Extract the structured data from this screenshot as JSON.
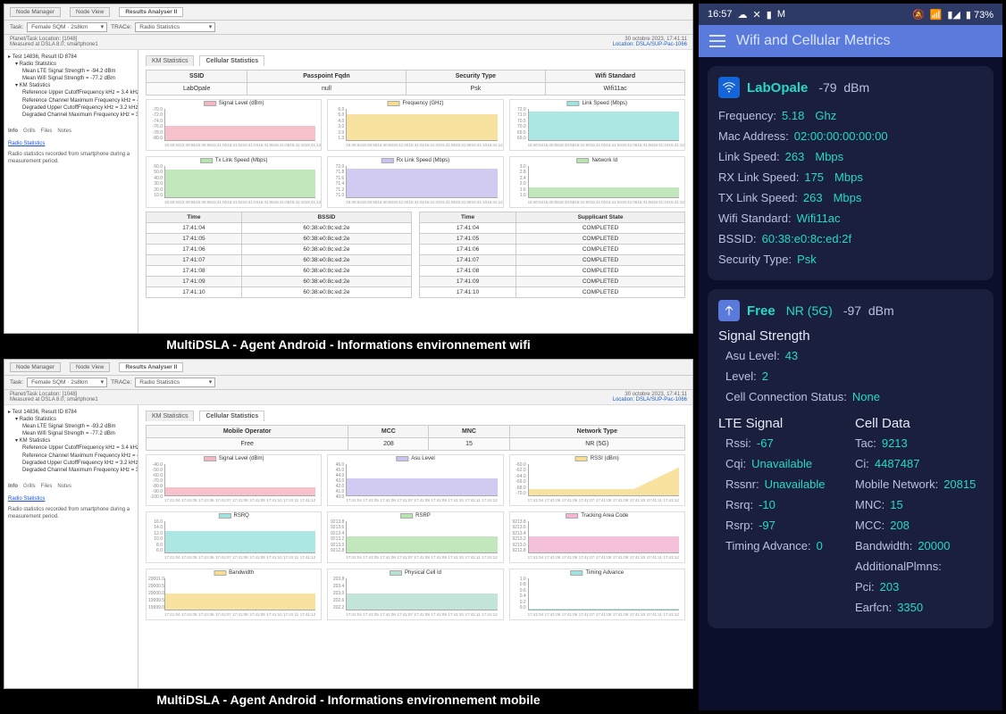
{
  "captions": {
    "wifi": "MultiDSLA - Agent Android - Informations environnement wifi",
    "cellular": "MultiDSLA - Agent Android - Informations environnement mobile"
  },
  "desktop_common": {
    "tabs": {
      "node_manager": "Node Manager",
      "node_view": "Node View",
      "results_analyser": "Results Analyser II"
    },
    "toolbar": {
      "task_label": "Task:",
      "task_value": "Female SQM · 2s8km",
      "trace_label": "TRACe:",
      "trace_value": "Radio Statistics"
    },
    "meta": {
      "left_line1": "Planet/Task Location: [1048]",
      "left_line2": "Measured at DSLA 8.0; smartphone1",
      "right_timestamp": "30 octobre 2023, 17:41:11",
      "right_loc": "Location: DSLA/SUP-Pac-1066"
    },
    "chart_tabs": {
      "km": "KM Statistics",
      "cellular": "Cellular Statistics"
    }
  },
  "wifi_panel": {
    "tree": {
      "root": "Test 14836, Result ID 8784",
      "children": [
        "Radio Statistics",
        "Mean LTE Signal Strength = -94.2 dBm",
        "Mean Wifi Signal Strength = -77.2 dBm",
        "KM Statistics",
        "Reference Upper CutoffFrequency kHz = 3.4 kHz",
        "Reference Channel Maximum Frequency kHz = 4.0 kHz",
        "Degraded Upper CutoffFrequency kHz = 3.2 kHz",
        "Degraded Channel Maximum Frequency kHz = 3.7 kHz"
      ],
      "bottom_tabs": [
        "Info",
        "Grills",
        "Files",
        "Notes"
      ],
      "link": "Radio Statistics",
      "description": "Radio statistics recorded from smartphone during a measurement period."
    },
    "info_headers": [
      "SSID",
      "Passpoint Fqdn",
      "Security Type",
      "Wifi Standard"
    ],
    "info_values": [
      "LabOpale",
      "null",
      "Psk",
      "Wifi11ac"
    ],
    "charts": [
      {
        "name": "Signal Level (dBm)",
        "color": "#f4b6c2",
        "yticks": [
          "-70.0",
          "-72.0",
          "-74.0",
          "-76.0",
          "-78.0",
          "-80.0"
        ],
        "fill_top": 0.55
      },
      {
        "name": "Frequency (GHz)",
        "color": "#f7dd8f",
        "yticks": [
          "6.0",
          "5.0",
          "4.0",
          "3.0",
          "2.0",
          "1.0"
        ],
        "fill_top": 0.18
      },
      {
        "name": "Link Speed (Mbps)",
        "color": "#9fe3df",
        "yticks": [
          "72.0",
          "71.0",
          "70.5",
          "70.0",
          "69.5",
          "69.0"
        ],
        "fill_top": 0.08
      },
      {
        "name": "Tx Link Speed (Mbps)",
        "color": "#b7e3b0",
        "yticks": [
          "60.0",
          "50.0",
          "40.0",
          "30.0",
          "20.0",
          "10.0"
        ],
        "fill_top": 0.1
      },
      {
        "name": "Rx Link Speed (Mbps)",
        "color": "#c9c1ef",
        "yticks": [
          "72.0",
          "71.8",
          "71.6",
          "71.4",
          "71.2",
          "71.0"
        ],
        "fill_top": 0.08
      },
      {
        "name": "Network Id",
        "color": "#b7e3b0",
        "yticks": [
          "3.0",
          "2.8",
          "2.4",
          "2.0",
          "1.6",
          "1.0"
        ],
        "fill_top": 0.68
      }
    ],
    "xticks": [
      "15:40:54",
      "15:40:56",
      "15:40:58",
      "15:41:00",
      "15:41:02",
      "15:41:04",
      "15:41:06",
      "15:41:08",
      "15:41:10",
      "15:41:12"
    ],
    "table_left": {
      "headers": [
        "Time",
        "BSSID"
      ],
      "rows": [
        [
          "17:41:04",
          "60:38:e0:8c:ed:2e"
        ],
        [
          "17:41:05",
          "60:38:e0:8c:ed:2e"
        ],
        [
          "17:41:06",
          "60:38:e0:8c:ed:2e"
        ],
        [
          "17:41:07",
          "60:38:e0:8c:ed:2e"
        ],
        [
          "17:41:08",
          "60:38:e0:8c:ed:2e"
        ],
        [
          "17:41:09",
          "60:38:e0:8c:ed:2e"
        ],
        [
          "17:41:10",
          "60:38:e0:8c:ed:2e"
        ]
      ]
    },
    "table_right": {
      "headers": [
        "Time",
        "Supplicant State"
      ],
      "rows": [
        [
          "17:41:04",
          "COMPLETED"
        ],
        [
          "17:41:05",
          "COMPLETED"
        ],
        [
          "17:41:06",
          "COMPLETED"
        ],
        [
          "17:41:07",
          "COMPLETED"
        ],
        [
          "17:41:08",
          "COMPLETED"
        ],
        [
          "17:41:09",
          "COMPLETED"
        ],
        [
          "17:41:10",
          "COMPLETED"
        ]
      ]
    }
  },
  "cell_panel": {
    "tree": {
      "root": "Test 14836, Result ID 8784",
      "children": [
        "Radio Statistics",
        "Mean LTE Signal Strength = -93.2 dBm",
        "Mean Wifi Signal Strength = -77.2 dBm",
        "KM Statistics",
        "Reference Upper CutoffFrequency kHz = 3.4 kHz",
        "Reference Channel Maximum Frequency kHz = 4.0 kHz",
        "Degraded Upper CutoffFrequency kHz = 3.2 kHz",
        "Degraded Channel Maximum Frequency kHz = 3.7 kHz"
      ],
      "bottom_tabs": [
        "Info",
        "Grills",
        "Files",
        "Notes"
      ],
      "link": "Radio Statistics",
      "description": "Radio statistics recorded from smartphone during a measurement period."
    },
    "info_headers": [
      "Mobile Operator",
      "MCC",
      "MNC",
      "Network Type"
    ],
    "info_values": [
      "Free",
      "208",
      "15",
      "NR (5G)"
    ],
    "charts": [
      {
        "name": "Signal Level (dBm)",
        "color": "#f4b6c2",
        "yticks": [
          "-40.0",
          "-50.0",
          "-60.0",
          "-70.0",
          "-80.0",
          "-90.0",
          "-100.0"
        ],
        "fill_top": 0.75
      },
      {
        "name": "Asu Level",
        "color": "#c9c1ef",
        "yticks": [
          "46.0",
          "45.0",
          "44.0",
          "43.0",
          "42.0",
          "41.0",
          "40.0"
        ],
        "fill_top": 0.45
      },
      {
        "name": "RSSI (dBm)",
        "color": "#f7dd8f",
        "yticks": [
          "-60.0",
          "-62.0",
          "-64.0",
          "-66.0",
          "-68.0",
          "-70.0"
        ],
        "fill_top": 0.15,
        "slope": true
      },
      {
        "name": "RSRQ",
        "color": "#9fe3df",
        "yticks": [
          "16.0",
          "14.0",
          "12.0",
          "10.0",
          "8.0",
          "6.0"
        ],
        "fill_top": 0.3
      },
      {
        "name": "RSRP",
        "color": "#b7e3b0",
        "yticks": [
          "9213.8",
          "9213.6",
          "9213.4",
          "9213.2",
          "9213.0",
          "9212.8"
        ],
        "fill_top": 0.48
      },
      {
        "name": "Tracking Area Code",
        "color": "#f2b5d4",
        "yticks": [
          "9213.8",
          "9213.6",
          "9213.4",
          "9213.2",
          "9213.0",
          "9212.8"
        ],
        "fill_top": 0.48
      },
      {
        "name": "Bandwidth",
        "color": "#f7dd8f",
        "yticks": [
          "20001.0",
          "20000.5",
          "20000.0",
          "19999.5",
          "19999.0"
        ],
        "fill_top": 0.48
      },
      {
        "name": "Physical Cell Id",
        "color": "#b8e0d2",
        "yticks": [
          "203.8",
          "203.4",
          "203.0",
          "202.6",
          "202.2"
        ],
        "fill_top": 0.48
      },
      {
        "name": "Timing Advance",
        "color": "#9fe3df",
        "yticks": [
          "1.0",
          "0.8",
          "0.6",
          "0.4",
          "0.2",
          "0.0"
        ],
        "fill_top": 0.96
      }
    ],
    "xticks": [
      "17:41:04",
      "17:41:05",
      "17:41:06",
      "17:41:07",
      "17:41:08",
      "17:41:09",
      "17:41:10",
      "17:41:11",
      "17:41:12"
    ]
  },
  "phone": {
    "status": {
      "time": "16:57",
      "battery": "73%"
    },
    "app_title": "Wifi and Cellular Metrics",
    "wifi": {
      "ssid": "LabOpale",
      "signal": "-79",
      "unit": "dBm",
      "rows": [
        {
          "k": "Frequency:",
          "v": "5.18",
          "u": "Ghz"
        },
        {
          "k": "Mac Address:",
          "v": "02:00:00:00:00:00"
        },
        {
          "k": "Link Speed:",
          "v": "263",
          "u": "Mbps"
        },
        {
          "k": "RX Link Speed:",
          "v": "175",
          "u": "Mbps"
        },
        {
          "k": "TX Link Speed:",
          "v": "263",
          "u": "Mbps"
        },
        {
          "k": "Wifi Standard:",
          "v": "Wifi11ac"
        },
        {
          "k": "BSSID:",
          "v": "60:38:e0:8c:ed:2f"
        },
        {
          "k": "Security Type:",
          "v": "Psk"
        }
      ]
    },
    "cell": {
      "op": "Free",
      "tech": "NR (5G)",
      "signal": "-97",
      "unit": "dBm",
      "strength_title": "Signal Strength",
      "strength": [
        {
          "k": "Asu Level:",
          "v": "43"
        },
        {
          "k": "Level:",
          "v": "2"
        },
        {
          "k": "Cell Connection Status:",
          "v": "None"
        }
      ],
      "lte_title": "LTE Signal",
      "cell_title": "Cell Data",
      "lte": [
        {
          "k": "Rssi:",
          "v": "-67"
        },
        {
          "k": "Cqi:",
          "v": "Unavailable"
        },
        {
          "k": "Rssnr:",
          "v": "Unavailable"
        },
        {
          "k": "Rsrq:",
          "v": "-10"
        },
        {
          "k": "Rsrp:",
          "v": "-97"
        },
        {
          "k": "Timing Advance:",
          "v": "0"
        }
      ],
      "celldata": [
        {
          "k": "Tac:",
          "v": "9213"
        },
        {
          "k": "Ci:",
          "v": "4487487"
        },
        {
          "k": "Mobile Network:",
          "v": "20815"
        },
        {
          "k": "MNC:",
          "v": "15"
        },
        {
          "k": "MCC:",
          "v": "208"
        },
        {
          "k": "Bandwidth:",
          "v": "20000"
        },
        {
          "k": "AdditionalPlmns:",
          "v": ""
        },
        {
          "k": "Pci:",
          "v": "203"
        },
        {
          "k": "Earfcn:",
          "v": "3350"
        }
      ]
    }
  },
  "chart_data": [
    {
      "panel": "wifi",
      "type": "line",
      "title": "Signal Level (dBm)",
      "x": [
        "15:40:54",
        "15:41:12"
      ],
      "series": [
        {
          "name": "Signal Level",
          "values": [
            -77,
            -77
          ]
        }
      ],
      "ylim": [
        -80,
        -70
      ]
    },
    {
      "panel": "wifi",
      "type": "line",
      "title": "Frequency (GHz)",
      "x": [
        "15:40:54",
        "15:41:12"
      ],
      "series": [
        {
          "name": "Frequency",
          "values": [
            5.18,
            5.18
          ]
        }
      ],
      "ylim": [
        1,
        6
      ]
    },
    {
      "panel": "wifi",
      "type": "line",
      "title": "Link Speed (Mbps)",
      "x": [
        "15:40:54",
        "15:41:12"
      ],
      "series": [
        {
          "name": "Link Speed",
          "values": [
            72,
            72
          ]
        }
      ],
      "ylim": [
        69,
        72
      ]
    },
    {
      "panel": "wifi",
      "type": "line",
      "title": "Tx Link Speed (Mbps)",
      "x": [
        "15:40:54",
        "15:41:12"
      ],
      "series": [
        {
          "name": "Tx",
          "values": [
            58,
            58
          ]
        }
      ],
      "ylim": [
        10,
        60
      ]
    },
    {
      "panel": "wifi",
      "type": "line",
      "title": "Rx Link Speed (Mbps)",
      "x": [
        "15:40:54",
        "15:41:12"
      ],
      "series": [
        {
          "name": "Rx",
          "values": [
            72,
            72
          ]
        }
      ],
      "ylim": [
        71,
        72
      ]
    },
    {
      "panel": "wifi",
      "type": "line",
      "title": "Network Id",
      "x": [
        "15:40:54",
        "15:41:12"
      ],
      "series": [
        {
          "name": "Network Id",
          "values": [
            1,
            1
          ]
        }
      ],
      "ylim": [
        1,
        3
      ]
    },
    {
      "panel": "cell",
      "type": "line",
      "title": "Signal Level (dBm)",
      "x": [
        "17:41:04",
        "17:41:12"
      ],
      "series": [
        {
          "name": "Signal",
          "values": [
            -93,
            -93
          ]
        }
      ],
      "ylim": [
        -100,
        -40
      ]
    },
    {
      "panel": "cell",
      "type": "line",
      "title": "Asu Level",
      "x": [
        "17:41:04",
        "17:41:12"
      ],
      "series": [
        {
          "name": "Asu",
          "values": [
            43,
            43
          ]
        }
      ],
      "ylim": [
        40,
        46
      ]
    },
    {
      "panel": "cell",
      "type": "line",
      "title": "RSSI (dBm)",
      "x": [
        "17:41:04",
        "17:41:12"
      ],
      "series": [
        {
          "name": "RSSI",
          "values": [
            -69,
            -61
          ]
        }
      ],
      "ylim": [
        -70,
        -60
      ]
    },
    {
      "panel": "cell",
      "type": "line",
      "title": "RSRQ",
      "x": [
        "17:41:04",
        "17:41:12"
      ],
      "series": [
        {
          "name": "RSRQ",
          "values": [
            12,
            12
          ]
        }
      ],
      "ylim": [
        6,
        16
      ]
    },
    {
      "panel": "cell",
      "type": "line",
      "title": "RSRP",
      "x": [
        "17:41:04",
        "17:41:12"
      ],
      "series": [
        {
          "name": "RSRP",
          "values": [
            9213.2,
            9213.2
          ]
        }
      ],
      "ylim": [
        9212.8,
        9213.8
      ]
    },
    {
      "panel": "cell",
      "type": "line",
      "title": "Tracking Area Code",
      "x": [
        "17:41:04",
        "17:41:12"
      ],
      "series": [
        {
          "name": "TAC",
          "values": [
            9213.2,
            9213.2
          ]
        }
      ],
      "ylim": [
        9212.8,
        9213.8
      ]
    },
    {
      "panel": "cell",
      "type": "line",
      "title": "Bandwidth",
      "x": [
        "17:41:04",
        "17:41:12"
      ],
      "series": [
        {
          "name": "BW",
          "values": [
            20000,
            20000
          ]
        }
      ],
      "ylim": [
        19999,
        20001
      ]
    },
    {
      "panel": "cell",
      "type": "line",
      "title": "Physical Cell Id",
      "x": [
        "17:41:04",
        "17:41:12"
      ],
      "series": [
        {
          "name": "PCI",
          "values": [
            203,
            203
          ]
        }
      ],
      "ylim": [
        202.2,
        203.8
      ]
    },
    {
      "panel": "cell",
      "type": "line",
      "title": "Timing Advance",
      "x": [
        "17:41:04",
        "17:41:12"
      ],
      "series": [
        {
          "name": "TA",
          "values": [
            0,
            0
          ]
        }
      ],
      "ylim": [
        0,
        1
      ]
    }
  ]
}
